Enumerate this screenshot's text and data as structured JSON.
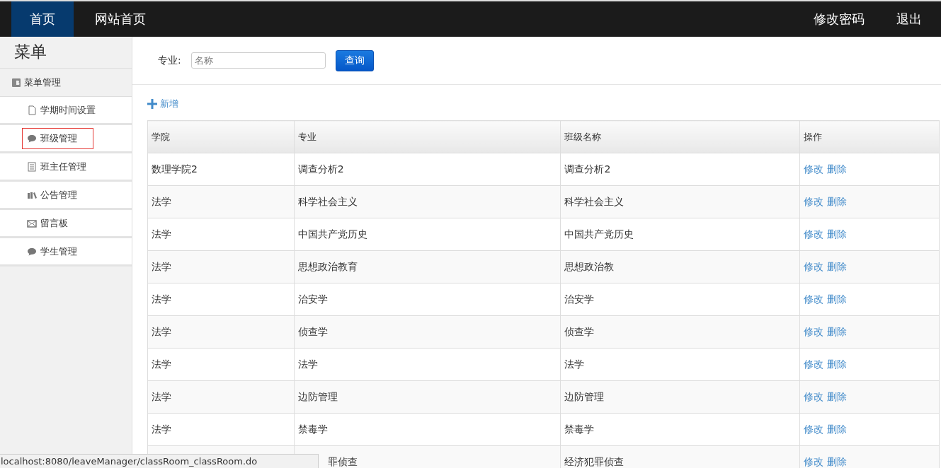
{
  "navbar": {
    "left": [
      {
        "label": "首页",
        "selected": true
      },
      {
        "label": "网站首页",
        "selected": false
      }
    ],
    "right": [
      "修改密码",
      "退出"
    ]
  },
  "sidebar": {
    "title": "菜单",
    "group": "菜单管理",
    "items": [
      {
        "label": "学期时间设置",
        "kind": "file",
        "selected": false
      },
      {
        "label": "班级管理",
        "kind": "comment",
        "selected": true
      },
      {
        "label": "班主任管理",
        "kind": "list",
        "selected": false
      },
      {
        "label": "公告管理",
        "kind": "books",
        "selected": false
      },
      {
        "label": "留言板",
        "kind": "mail",
        "selected": false
      },
      {
        "label": "学生管理",
        "kind": "comment",
        "selected": false
      }
    ]
  },
  "search": {
    "label": "专业:",
    "placeholder": "名称",
    "button": "查询"
  },
  "add_link": "新增",
  "table": {
    "columns": [
      "学院",
      "专业",
      "班级名称",
      "操作"
    ],
    "rows": [
      {
        "college": "数理学院2",
        "major": "调查分析2",
        "class_name": "调查分析2",
        "actions": [
          "修改",
          "删除"
        ]
      },
      {
        "college": "法学",
        "major": "科学社会主义",
        "class_name": "科学社会主义",
        "actions": [
          "修改",
          "删除"
        ]
      },
      {
        "college": "法学",
        "major": "中国共产党历史",
        "class_name": "中国共产党历史",
        "actions": [
          "修改",
          "删除"
        ]
      },
      {
        "college": "法学",
        "major": "思想政治教育",
        "class_name": "思想政治教",
        "actions": [
          "修改",
          "删除"
        ]
      },
      {
        "college": "法学",
        "major": "治安学",
        "class_name": "治安学",
        "actions": [
          "修改",
          "删除"
        ]
      },
      {
        "college": "法学",
        "major": "侦查学",
        "class_name": "侦查学",
        "actions": [
          "修改",
          "删除"
        ]
      },
      {
        "college": "法学",
        "major": "法学",
        "class_name": "法学",
        "actions": [
          "修改",
          "删除"
        ]
      },
      {
        "college": "法学",
        "major": "边防管理",
        "class_name": "边防管理",
        "actions": [
          "修改",
          "删除"
        ]
      },
      {
        "college": "法学",
        "major": "禁毒学",
        "class_name": "禁毒学",
        "actions": [
          "修改",
          "删除"
        ]
      },
      {
        "major": "罪侦查",
        "class_name": "经济犯罪侦查",
        "actions": [
          "修改",
          "删除"
        ]
      }
    ]
  },
  "status_bar": "localhost:8080/leaveManager/classRoom_classRoom.do"
}
